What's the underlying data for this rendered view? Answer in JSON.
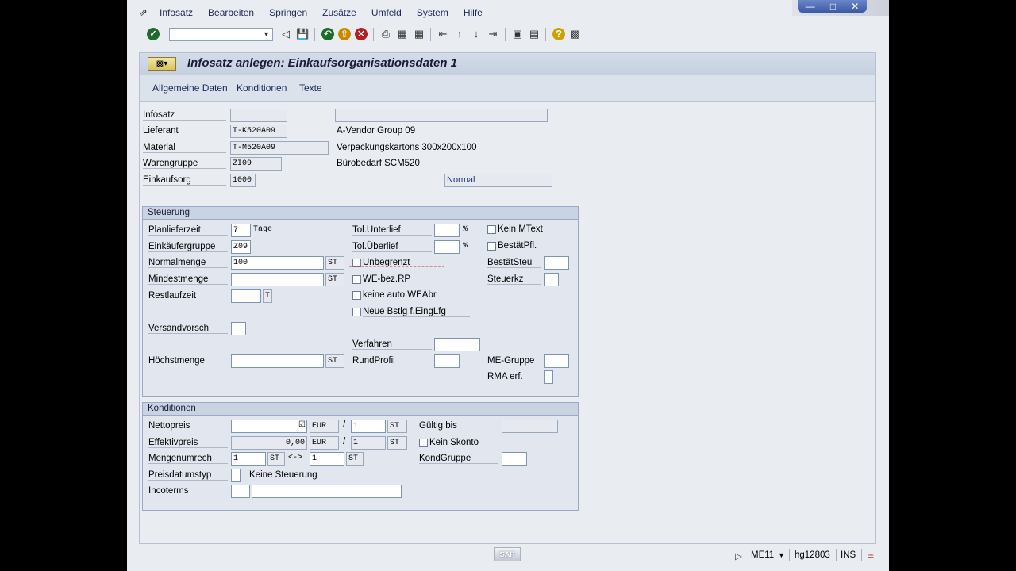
{
  "menubar": {
    "items": [
      {
        "label": "Infosatz",
        "accel": "I"
      },
      {
        "label": "Bearbeiten",
        "accel": "B"
      },
      {
        "label": "Springen",
        "accel": "S"
      },
      {
        "label": "Zusätze",
        "accel": "Z"
      },
      {
        "label": "Umfeld",
        "accel": "U"
      },
      {
        "label": "System",
        "accel": "y"
      },
      {
        "label": "Hilfe",
        "accel": "H"
      }
    ]
  },
  "toolbar": {
    "command_value": ""
  },
  "window": {
    "title": "Infosatz anlegen: Einkaufsorganisationsdaten 1"
  },
  "tabs": [
    "Allgemeine Daten",
    "Konditionen",
    "Texte"
  ],
  "header": {
    "infosatz_label": "Infosatz",
    "infosatz_value": "",
    "infosatz_desc": "",
    "lieferant_label": "Lieferant",
    "lieferant_value": "T-K520A09",
    "lieferant_desc": "A-Vendor Group 09",
    "material_label": "Material",
    "material_value": "T-M520A09",
    "material_desc": "Verpackungskartons 300x200x100",
    "warengruppe_label": "Warengruppe",
    "warengruppe_value": "ZI09",
    "warengruppe_desc": "Bürobedarf SCM520",
    "einkaufsorg_label": "Einkaufsorg",
    "einkaufsorg_value": "1000",
    "type_value": "Normal"
  },
  "steuerung": {
    "title": "Steuerung",
    "planlieferzeit_label": "Planlieferzeit",
    "planlieferzeit_value": "7",
    "planlieferzeit_unit": "Tage",
    "einkaeufergruppe_label": "Einkäufergruppe",
    "einkaeufergruppe_value": "Z09",
    "normalmenge_label": "Normalmenge",
    "normalmenge_value": "100",
    "normalmenge_unit": "ST",
    "mindestmenge_label": "Mindestmenge",
    "mindestmenge_value": "",
    "mindestmenge_unit": "ST",
    "restlaufzeit_label": "Restlaufzeit",
    "restlaufzeit_value": "",
    "restlaufzeit_unit": "T",
    "versandvorsch_label": "Versandvorsch",
    "hoechstmenge_label": "Höchstmenge",
    "hoechstmenge_unit": "ST",
    "tol_unterlief_label": "Tol.Unterlief",
    "tol_ueberlief_label": "Tol.Überlief",
    "percent": "%",
    "unbegrenzt_label": "Unbegrenzt",
    "we_bez_rp_label": "WE-bez.RP",
    "keine_auto_weabr_label": "keine auto WEAbr",
    "neue_bstlg_label": "Neue Bstlg f.EingLfg",
    "verfahren_label": "Verfahren",
    "rundprofil_label": "RundProfil",
    "kein_mtext_label": "Kein MText",
    "bestaetpfl_label": "BestätPfl.",
    "bestaetsteu_label": "BestätSteu",
    "steuerkz_label": "Steuerkz",
    "me_gruppe_label": "ME-Gruppe",
    "rma_erf_label": "RMA erf."
  },
  "konditionen": {
    "title": "Konditionen",
    "nettopreis_label": "Nettopreis",
    "nettopreis_value": "",
    "nettopreis_currency": "EUR",
    "nettopreis_per": "1",
    "nettopreis_unit": "ST",
    "effektivpreis_label": "Effektivpreis",
    "effektivpreis_value": "0,00",
    "effektivpreis_currency": "EUR",
    "effektivpreis_per": "1",
    "effektivpreis_unit": "ST",
    "slash": "/",
    "mengenumrech_label": "Mengenumrech",
    "mengenumrech_value1": "1",
    "mengenumrech_unit1": "ST",
    "mengenumrech_arrow": "<->",
    "mengenumrech_value2": "1",
    "mengenumrech_unit2": "ST",
    "preisdatumstyp_label": "Preisdatumstyp",
    "preisdatumstyp_desc": "Keine Steuerung",
    "incoterms_label": "Incoterms",
    "gueltig_bis_label": "Gültig bis",
    "kein_skonto_label": "Kein Skonto",
    "kondgruppe_label": "KondGruppe"
  },
  "statusbar": {
    "sap_badge": "SAP",
    "transaction": "ME11",
    "server": "hg12803",
    "mode": "INS"
  }
}
